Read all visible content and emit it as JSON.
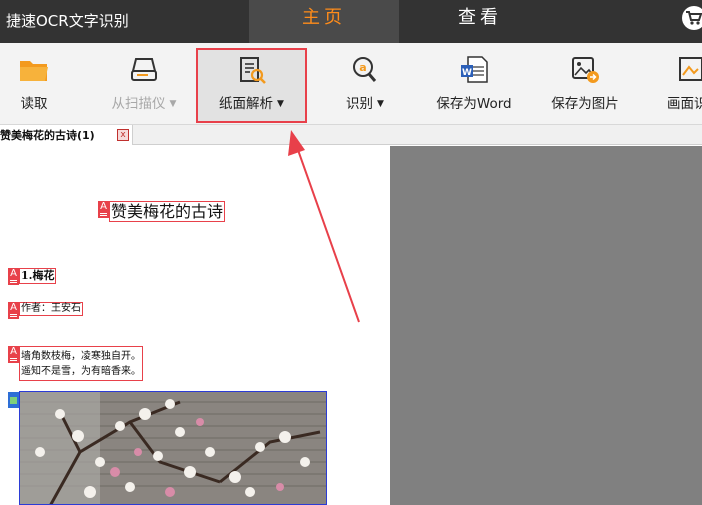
{
  "app": {
    "title": "捷速OCR文字识别"
  },
  "tabs": [
    {
      "label": "主页",
      "active": true
    },
    {
      "label": "查看",
      "active": false
    }
  ],
  "toolbar": {
    "read": "读取",
    "scanner": "从扫描仪",
    "paper_parse": "纸面解析",
    "recognize": "识别",
    "save_word": "保存为Word",
    "save_image": "保存为图片",
    "screen_capture": "画面识"
  },
  "document": {
    "tab_label": "赞美梅花的古诗(1)",
    "close_glyph": "x",
    "title": "赞美梅花的古诗",
    "section": "1.梅花",
    "author": "作者：王安石",
    "line1": "墙角数枝梅，凌寒独自开。",
    "line2": "遥知不是雪，为有暗香来。"
  },
  "colors": {
    "accent": "#ff8c1a",
    "highlight": "#e8404a",
    "titlebar": "#333333",
    "image_box": "#2b3bd6"
  }
}
